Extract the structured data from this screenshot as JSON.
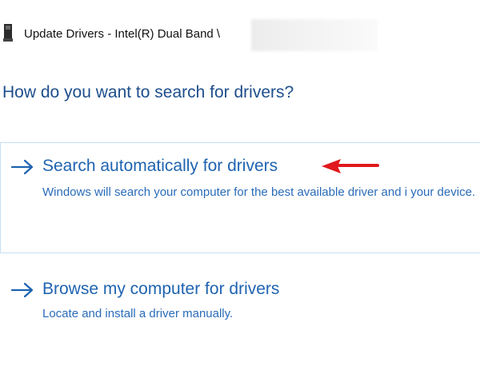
{
  "window": {
    "title": "Update Drivers - Intel(R) Dual Band \\"
  },
  "heading": "How do you want to search for drivers?",
  "options": [
    {
      "title": "Search automatically for drivers",
      "description": "Windows will search your computer for the best available driver and i your device."
    },
    {
      "title": "Browse my computer for drivers",
      "description": "Locate and install a driver manually."
    }
  ],
  "icons": {
    "window_icon": "device-icon",
    "option_arrow": "arrow-right-icon",
    "annotation": "red-arrow-annotation"
  },
  "colors": {
    "heading": "#1e4e8c",
    "link": "#1f63b0",
    "selected_border": "#c7dff2",
    "annotation": "#e0191e"
  }
}
